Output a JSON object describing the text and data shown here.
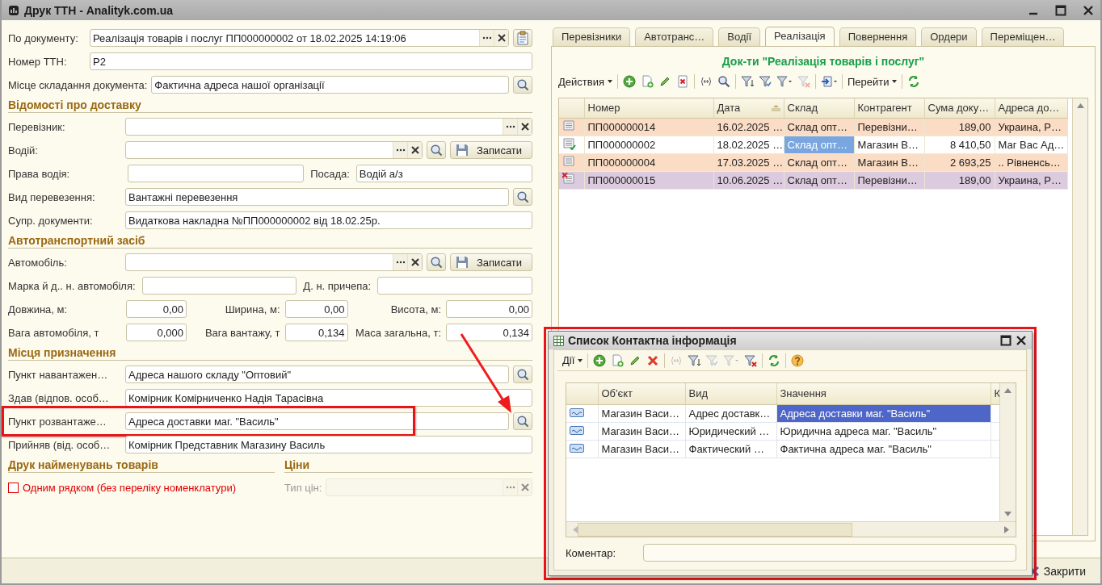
{
  "window": {
    "title": "Друк ТТН - Analityk.com.ua"
  },
  "form": {
    "document_rows": [
      {
        "fields": [
          {
            "kind": "text",
            "label": "По документу:",
            "value": "Реалізація товарів і послуг ПП000000002 от 18.02.2025 14:19:06",
            "select_button": true,
            "clear_button": true
          }
        ],
        "document_button": true
      },
      {
        "fields": [
          {
            "kind": "text",
            "label": "Номер ТТН:",
            "value": "P2"
          }
        ]
      },
      {
        "fields": [
          {
            "kind": "text",
            "label": "Місце складання документа:",
            "value": "Фактична адреса нашої організації"
          }
        ],
        "lookup_button": true
      }
    ],
    "sections": [
      {
        "kind": "full",
        "title": "Відомості про доставку",
        "rows": [
          {
            "fields": [
              {
                "kind": "text",
                "label": "Перевізник:",
                "select_button": true,
                "clear_button": true
              }
            ]
          },
          {
            "fields": [
              {
                "kind": "text",
                "label": "Водій:",
                "select_button": true,
                "clear_button": true
              }
            ],
            "lookup_button": true,
            "action_button": "Записати"
          },
          {
            "fields": [
              {
                "kind": "text",
                "label": "Права водія:"
              },
              {
                "kind": "text",
                "label": "Посада:",
                "value": "Водій а/з"
              }
            ]
          },
          {
            "fields": [
              {
                "kind": "text",
                "label": "Вид перевезення:",
                "value": "Вантажні перевезення"
              }
            ],
            "lookup_button": true
          },
          {
            "fields": [
              {
                "kind": "text",
                "label": "Супр. документи:",
                "value": "Видаткова накладна №ПП000000002 від 18.02.25р."
              }
            ]
          }
        ]
      },
      {
        "kind": "full",
        "title": "Автотранспортний засіб",
        "rows": [
          {
            "fields": [
              {
                "kind": "text",
                "label": "Автомобіль:",
                "select_button": true,
                "clear_button": true
              }
            ],
            "lookup_button": true,
            "action_button": "Записати"
          },
          {
            "fields": [
              {
                "kind": "text",
                "label": "Марка й д.. н. автомобіля:"
              },
              {
                "kind": "text",
                "label": "Д. н. причепа:"
              }
            ]
          },
          {
            "fields": [
              {
                "kind": "number",
                "label": "Довжина, м:",
                "value": "0,00"
              },
              {
                "kind": "number",
                "label": "Ширина, м:",
                "value": "0,00"
              },
              {
                "kind": "number",
                "label": "Висота, м:",
                "value": "0,00"
              }
            ]
          },
          {
            "fields": [
              {
                "kind": "number",
                "label": "Вага автомобіля, т",
                "value": "0,000"
              },
              {
                "kind": "number",
                "label": "Вага вантажу, т",
                "value": "0,134"
              },
              {
                "kind": "number",
                "label": "Маса загальна, т:",
                "value": "0,134"
              }
            ]
          }
        ]
      },
      {
        "kind": "full",
        "title": "Місця призначення",
        "rows": [
          {
            "fields": [
              {
                "kind": "text",
                "label": "Пункт навантажен…",
                "value": "Адреса нашого складу \"Оптовий\""
              }
            ],
            "lookup_button": true
          },
          {
            "fields": [
              {
                "kind": "text",
                "label": "Здав (відпов. особ…",
                "value": "Комірник Комірниченко Надія Тарасівна"
              }
            ]
          },
          {
            "fields": [
              {
                "kind": "text",
                "label": "Пункт розвантаже…",
                "value": "Адреса доставки маг. \"Василь\""
              }
            ],
            "lookup_button": true,
            "annotated": true
          },
          {
            "fields": [
              {
                "kind": "text",
                "label": "Прийняв (від. особ…",
                "value": "Комірник Представник Магазину Василь"
              }
            ]
          }
        ]
      },
      {
        "kind": "pair",
        "parts": [
          {
            "title": "Друк найменувань товарів",
            "rows": [
              {
                "fields": [
                  {
                    "kind": "checkbox",
                    "label": "Одним рядком (без переліку номенклатури)",
                    "checked": false
                  }
                ]
              }
            ]
          },
          {
            "title": "Ціни",
            "rows": [
              {
                "fields": [
                  {
                    "kind": "text",
                    "label": "Тип цін:",
                    "disabled": true,
                    "select_button": true,
                    "clear_button": true
                  }
                ]
              }
            ]
          }
        ]
      }
    ]
  },
  "docs": {
    "tabs": [
      {
        "label": "Перевізники",
        "selected": false
      },
      {
        "label": "Автотранс…",
        "selected": false
      },
      {
        "label": "Водії",
        "selected": false
      },
      {
        "label": "Реалізація",
        "selected": true
      },
      {
        "label": "Повернення",
        "selected": false
      },
      {
        "label": "Ордери",
        "selected": false
      },
      {
        "label": "Переміщен…",
        "selected": false
      }
    ],
    "title": "Док-ти \"Реалізація товарів і послуг\"",
    "toolbar": [
      {
        "kind": "menu",
        "label": "Действия",
        "disabled": false
      },
      {
        "kind": "separator"
      },
      {
        "kind": "add",
        "disabled": false
      },
      {
        "kind": "copy",
        "disabled": false
      },
      {
        "kind": "edit",
        "disabled": false
      },
      {
        "kind": "delete",
        "disabled": false
      },
      {
        "kind": "separator"
      },
      {
        "kind": "interval",
        "disabled": false
      },
      {
        "kind": "find",
        "disabled": false
      },
      {
        "kind": "separator"
      },
      {
        "kind": "filter",
        "disabled": false
      },
      {
        "kind": "filter-list",
        "disabled": false
      },
      {
        "kind": "filter-menu",
        "disabled": false
      },
      {
        "kind": "filter-clear",
        "disabled": true
      },
      {
        "kind": "separator"
      },
      {
        "kind": "export",
        "disabled": false
      },
      {
        "kind": "separator"
      },
      {
        "kind": "menu",
        "label": "Перейти",
        "disabled": false
      },
      {
        "kind": "separator"
      },
      {
        "kind": "refresh",
        "disabled": false
      }
    ],
    "table": {
      "columns": [
        {
          "label": "Номер",
          "kind": "text",
          "sorted": false
        },
        {
          "label": "Дата",
          "kind": "text",
          "sorted": true
        },
        {
          "label": "Склад",
          "kind": "text",
          "sorted": false
        },
        {
          "label": "Контрагент",
          "kind": "text",
          "sorted": false
        },
        {
          "label": "Сума доку…",
          "kind": "number",
          "sorted": false
        },
        {
          "label": "Адреса до…",
          "kind": "text",
          "sorted": false
        }
      ],
      "rows": [
        {
          "kind": "normal",
          "color": "#fbdcc4",
          "cells": [
            {
              "text": "ПП000000014",
              "selected": false
            },
            {
              "text": "16.02.2025 …",
              "selected": false
            },
            {
              "text": "Склад опт…",
              "selected": false
            },
            {
              "text": "Перевізни…",
              "selected": false
            },
            {
              "text": "189,00",
              "selected": false
            },
            {
              "text": "Украина, Р…",
              "selected": false
            }
          ]
        },
        {
          "kind": "posted",
          "color": "#ffffff",
          "cells": [
            {
              "text": "ПП000000002",
              "selected": false
            },
            {
              "text": "18.02.2025 …",
              "selected": false
            },
            {
              "text": "Склад опт…",
              "selected": true
            },
            {
              "text": "Магазин В…",
              "selected": false
            },
            {
              "text": "8 410,50",
              "selected": false
            },
            {
              "text": "Маг Вас Ад…",
              "selected": false
            }
          ]
        },
        {
          "kind": "normal",
          "color": "#fbdcc4",
          "cells": [
            {
              "text": "ПП000000004",
              "selected": false
            },
            {
              "text": "17.03.2025 …",
              "selected": false
            },
            {
              "text": "Склад опт…",
              "selected": false
            },
            {
              "text": "Магазин В…",
              "selected": false
            },
            {
              "text": "2 693,25",
              "selected": false
            },
            {
              "text": ".. Рівненсь…",
              "selected": false
            }
          ]
        },
        {
          "kind": "deleted",
          "color": "#dccbdf",
          "cells": [
            {
              "text": "ПП000000015",
              "selected": false
            },
            {
              "text": "10.06.2025 …",
              "selected": false
            },
            {
              "text": "Склад опт…",
              "selected": false
            },
            {
              "text": "Перевізни…",
              "selected": false
            },
            {
              "text": "189,00",
              "selected": false
            },
            {
              "text": "Украина, Р…",
              "selected": false
            }
          ]
        }
      ]
    }
  },
  "popup": {
    "title": "Список Контактна інформація",
    "annotated": true,
    "toolbar": [
      {
        "kind": "menu",
        "label": "Дії",
        "disabled": false
      },
      {
        "kind": "separator"
      },
      {
        "kind": "add",
        "disabled": false
      },
      {
        "kind": "copy",
        "disabled": false
      },
      {
        "kind": "edit",
        "disabled": false
      },
      {
        "kind": "remove",
        "disabled": false
      },
      {
        "kind": "separator"
      },
      {
        "kind": "interval",
        "disabled": true
      },
      {
        "kind": "filter",
        "disabled": false
      },
      {
        "kind": "filter-list",
        "disabled": true
      },
      {
        "kind": "filter-menu",
        "disabled": true
      },
      {
        "kind": "filter-clear",
        "disabled": false
      },
      {
        "kind": "separator"
      },
      {
        "kind": "refresh",
        "disabled": false
      },
      {
        "kind": "separator"
      },
      {
        "kind": "help",
        "disabled": false
      }
    ],
    "table": {
      "columns": [
        {
          "label": "Об'єкт"
        },
        {
          "label": "Вид"
        },
        {
          "label": "Значення"
        },
        {
          "label": "К"
        }
      ],
      "rows": [
        {
          "cells": [
            {
              "text": "Магазин Васи…",
              "selected": false
            },
            {
              "text": "Адрес доставк…",
              "selected": false
            },
            {
              "text": "Адреса доставки маг. \"Василь\"",
              "selected": true
            }
          ]
        },
        {
          "cells": [
            {
              "text": "Магазин Васи…",
              "selected": false
            },
            {
              "text": "Юридический …",
              "selected": false
            },
            {
              "text": "Юридична адреса маг. \"Василь\"",
              "selected": false
            }
          ]
        },
        {
          "cells": [
            {
              "text": "Магазин Васи…",
              "selected": false
            },
            {
              "text": "Фактический …",
              "selected": false
            },
            {
              "text": "Фактична адреса маг. \"Василь\"",
              "selected": false
            }
          ]
        }
      ]
    },
    "comment": {
      "label": "Коментар:"
    }
  },
  "bottom_bar": {
    "buttons": [
      {
        "kind": "close",
        "label": "Закрити"
      }
    ]
  }
}
